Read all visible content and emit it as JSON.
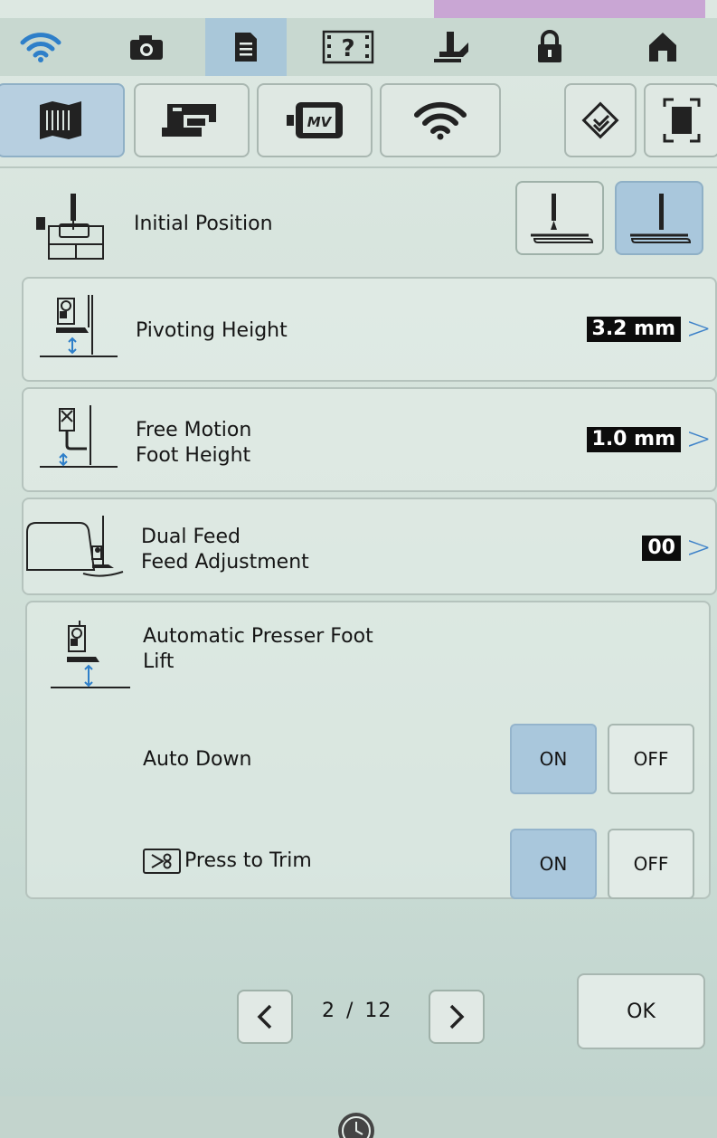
{
  "topbar": {
    "icons": [
      "wifi-icon",
      "camera-icon",
      "document-icon",
      "help-icon",
      "presser-foot-icon",
      "lock-icon",
      "home-icon"
    ]
  },
  "tabs": [
    "sewing-settings-icon",
    "machine-icon",
    "embroidery-frame-icon",
    "wifi-icon",
    "eco-mode-icon",
    "screen-icon"
  ],
  "rows": {
    "initial_position": {
      "label": "Initial Position"
    },
    "pivoting_height": {
      "label": "Pivoting Height",
      "value": "3.2 mm"
    },
    "free_motion": {
      "label_1": "Free Motion",
      "label_2": "Foot Height",
      "value": "1.0 mm"
    },
    "dual_feed": {
      "label_1": "Dual Feed",
      "label_2": "Feed Adjustment",
      "value": "00"
    },
    "auto_lift": {
      "label_1": "Automatic Presser Foot",
      "label_2": "Lift",
      "auto_down": {
        "label": "Auto Down",
        "on": "ON",
        "off": "OFF",
        "state": "ON"
      },
      "press_trim": {
        "label": "Press to Trim",
        "on": "ON",
        "off": "OFF",
        "state": "ON"
      }
    }
  },
  "pagination": {
    "current": "2",
    "sep": "/",
    "total": "12"
  },
  "ok_label": "OK",
  "colors": {
    "accent": "#3f83c9",
    "selected": "#a9c7dc",
    "value_bg": "#0c0c0c"
  }
}
